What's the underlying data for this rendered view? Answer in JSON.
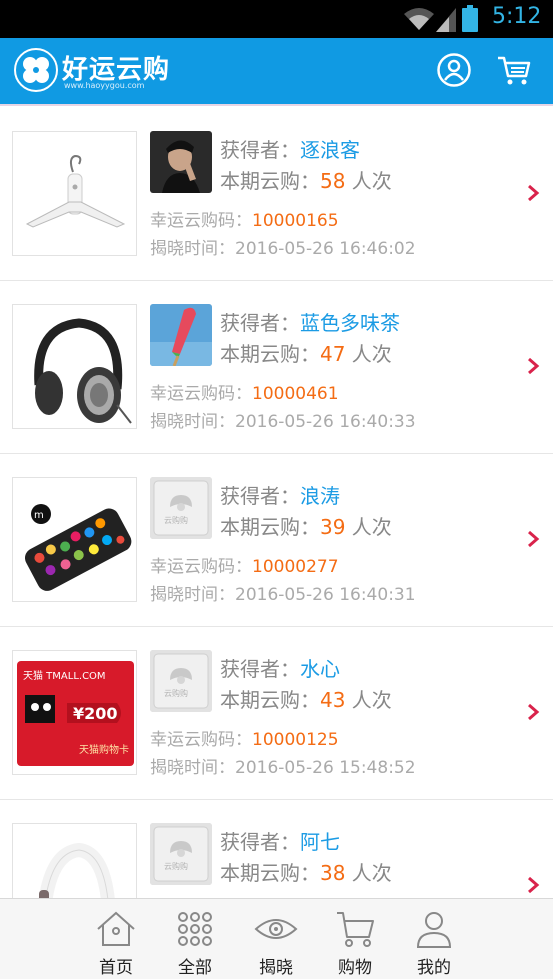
{
  "status_bar": {
    "time": "5:12",
    "icons": [
      "wifi-icon",
      "signal-icon",
      "battery-icon"
    ]
  },
  "header": {
    "brand": "好运云购",
    "brand_url": "www.haoyygou.com",
    "icons": [
      "user-icon",
      "cart-icon"
    ]
  },
  "labels": {
    "winner": "获得者：",
    "count_prefix": "本期云购：",
    "count_suffix": " 人次",
    "code": "幸运云购码：",
    "time": "揭晓时间："
  },
  "records": [
    {
      "winner": "逐浪客",
      "count": "58",
      "code": "10000165",
      "time": "2016-05-26 16:46:02",
      "product": "white-clothes-hanger",
      "avatar": "photo-man"
    },
    {
      "winner": "蓝色多味茶",
      "count": "47",
      "code": "10000461",
      "time": "2016-05-26 16:40:33",
      "product": "black-headphones",
      "avatar": "photo-watermelon"
    },
    {
      "winner": "浪涛",
      "count": "39",
      "code": "10000277",
      "time": "2016-05-26 16:40:31",
      "product": "decorated-power-bank",
      "avatar": "default-avatar"
    },
    {
      "winner": "水心",
      "count": "43",
      "code": "10000125",
      "time": "2016-05-26 15:48:52",
      "product": "tmall-gift-card",
      "avatar": "default-avatar"
    },
    {
      "winner": "阿七",
      "count": "38",
      "code": "",
      "time": "",
      "product": "white-headphones",
      "avatar": "default-avatar"
    }
  ],
  "product_art": {
    "gift_card_brand": "天猫 TMALL.COM",
    "gift_card_value": "¥200",
    "gift_card_caption": "天猫购物卡",
    "default_avatar_text": "云购购"
  },
  "tabbar": [
    {
      "label": "首页",
      "icon": "home-icon"
    },
    {
      "label": "全部",
      "icon": "grid-icon"
    },
    {
      "label": "揭晓",
      "icon": "eye-icon"
    },
    {
      "label": "购物",
      "icon": "cart-icon"
    },
    {
      "label": "我的",
      "icon": "user-icon"
    }
  ],
  "colors": {
    "header": "#109ae3",
    "accent_orange": "#f46c14",
    "link_blue": "#1b9be4",
    "chevron": "#d9234b"
  }
}
